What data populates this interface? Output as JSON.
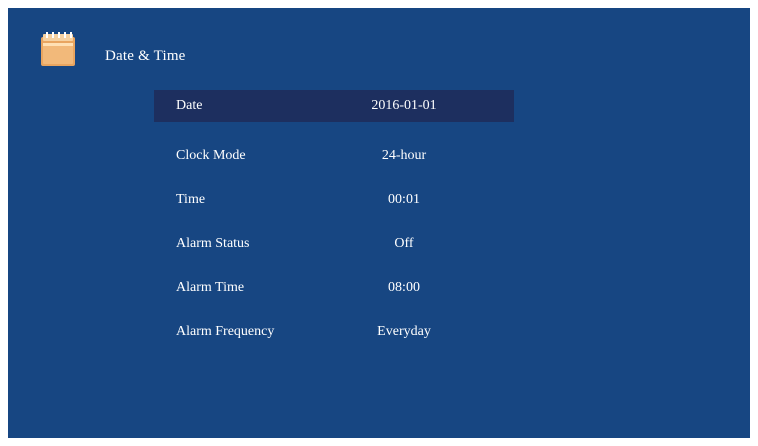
{
  "header": {
    "icon": "calendar-folder-icon",
    "title": "Date & Time"
  },
  "menu": {
    "items": [
      {
        "label": "Date",
        "value": "2016-01-01",
        "selected": true
      },
      {
        "label": "Clock Mode",
        "value": "24-hour"
      },
      {
        "label": "Time",
        "value": "00:01"
      },
      {
        "label": "Alarm Status",
        "value": "Off"
      },
      {
        "label": "Alarm Time",
        "value": "08:00"
      },
      {
        "label": "Alarm Frequency",
        "value": "Everyday"
      }
    ]
  },
  "colors": {
    "background": "#174682",
    "selection": "#1d2f5f",
    "text": "#ffffff",
    "icon_orange": "#e9a560",
    "icon_light": "#f6d2a2"
  }
}
